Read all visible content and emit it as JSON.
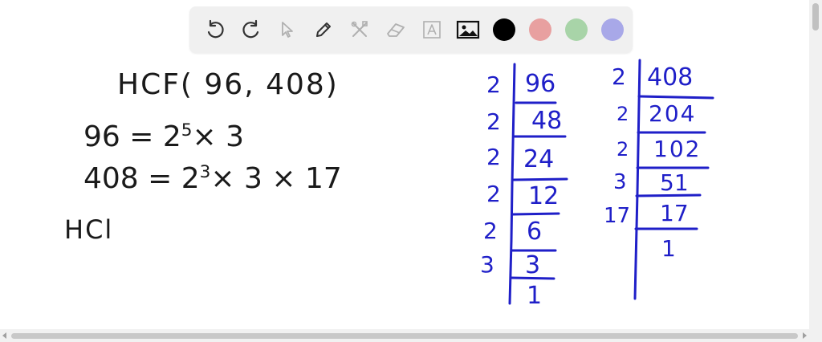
{
  "colors": {
    "toolbar_bg": "#f0f0f0",
    "swatch_black": "#000000",
    "swatch_red": "#e8a0a0",
    "swatch_green": "#a8d4a8",
    "swatch_blue": "#a8a8e8",
    "ink_black": "#1a1a1a",
    "ink_blue": "#1f1fc8"
  },
  "toolbar": {
    "tools": [
      "undo-icon",
      "redo-icon",
      "pointer-icon",
      "pen-icon",
      "tools-icon",
      "eraser-icon",
      "text-icon",
      "image-icon"
    ]
  },
  "notes": {
    "title": "HCF( 96, 408)",
    "line1_base": "96 = 2",
    "line1_exp": "5",
    "line1_rest": "× 3",
    "line2_base": "408 = 2",
    "line2_exp": "3",
    "line2_rest": "× 3 × 17",
    "line3": "HCl"
  },
  "division_96": {
    "divisors": [
      "2",
      "2",
      "2",
      "2",
      "2",
      "3"
    ],
    "quotients": [
      "96",
      "48",
      "24",
      "12",
      "6",
      "3",
      "1"
    ]
  },
  "division_408": {
    "divisors": [
      "2",
      "2",
      "2",
      "3",
      "17"
    ],
    "quotients": [
      "408",
      "204",
      "102",
      "51",
      "17",
      "1"
    ]
  }
}
